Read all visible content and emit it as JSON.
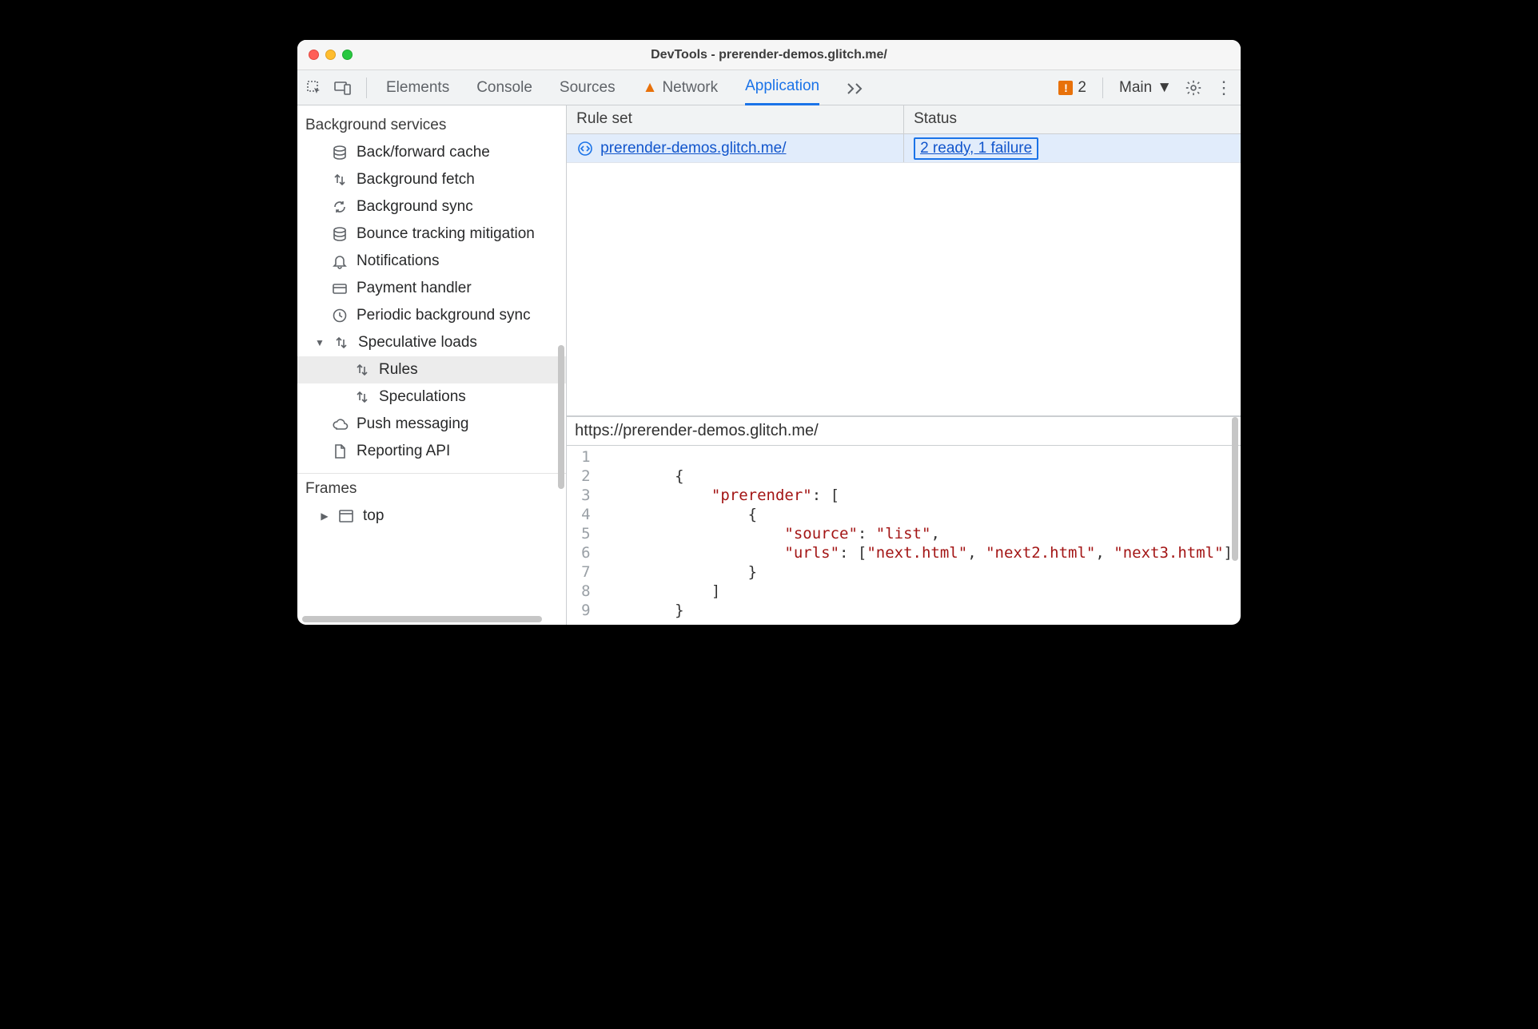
{
  "window": {
    "title": "DevTools - prerender-demos.glitch.me/"
  },
  "toolbar": {
    "tabs": {
      "elements": "Elements",
      "console": "Console",
      "sources": "Sources",
      "network": "Network",
      "application": "Application"
    },
    "issues_count": "2",
    "context": "Main"
  },
  "sidebar": {
    "section_bgservices": "Background services",
    "items": {
      "bfcache": "Back/forward cache",
      "bgfetch": "Background fetch",
      "bgsync": "Background sync",
      "bounce": "Bounce tracking mitigation",
      "notifications": "Notifications",
      "payment": "Payment handler",
      "periodic": "Periodic background sync",
      "speculative": "Speculative loads",
      "rules": "Rules",
      "speculations": "Speculations",
      "push": "Push messaging",
      "reporting": "Reporting API"
    },
    "section_frames": "Frames",
    "frames_top": "top"
  },
  "grid": {
    "col_ruleset": "Rule set",
    "col_status": "Status",
    "row": {
      "ruleset": " prerender-demos.glitch.me/",
      "status": "2 ready,  1 failure"
    }
  },
  "details": {
    "url": "https://prerender-demos.glitch.me/",
    "code_lines": [
      "",
      "        {",
      "            \"prerender\": [",
      "                {",
      "                    \"source\": \"list\",",
      "                    \"urls\": [\"next.html\", \"next2.html\", \"next3.html\"]",
      "                }",
      "            ]",
      "        }"
    ]
  }
}
